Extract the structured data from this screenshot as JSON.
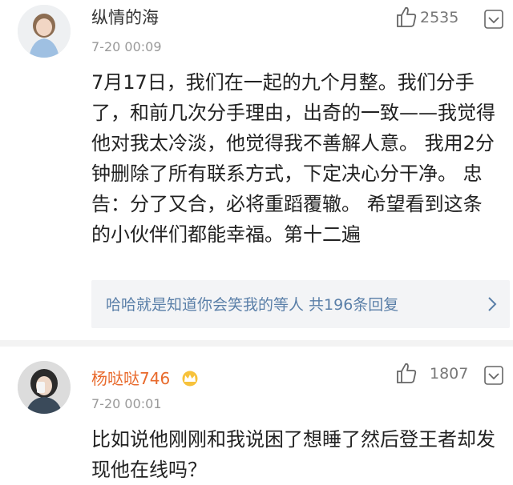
{
  "comments": [
    {
      "name": "纵情的海",
      "time": "7-20 00:09",
      "likes": "2535",
      "text": "7月17日，我们在一起的九个月整。我们分手了，和前几次分手理由，出奇的一致——我觉得他对我太冷淡，他觉得我不善解人意。 我用2分钟删除了所有联系方式，下定决心分干净。 忠告：分了又合，必将重蹈覆辙。 希望看到这条的小伙伴们都能幸福。第十二遍",
      "reply_summary": "哈哈就是知道你会笑我的等人 共196条回复"
    },
    {
      "name": "杨哒哒746",
      "time": "7-20 00:01",
      "likes": "1807",
      "text": "比如说他刚刚和我说困了想睡了然后登王者却发现他在线吗？"
    }
  ],
  "colors": {
    "link": "#5a7fa8",
    "username_highlight": "#e86a2c",
    "meta": "#999999"
  },
  "icons": {
    "like": "thumbs-up-icon",
    "more": "dropdown-chevron-icon",
    "crown": "crown-icon"
  }
}
